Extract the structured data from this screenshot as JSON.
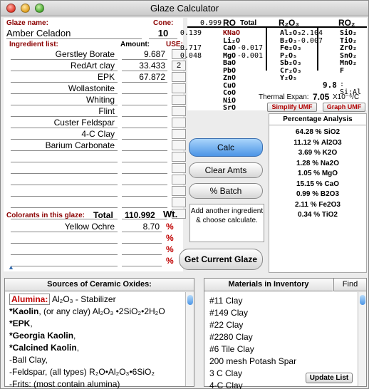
{
  "window": {
    "title": "Glaze Calculator"
  },
  "glaze": {
    "name_label": "Glaze name:",
    "name": "Amber Celadon",
    "cone_label": "Cone:",
    "cone": "10"
  },
  "ingredients": {
    "label": "Ingredient list:",
    "amount_label": "Amount:",
    "use_label": "USE:",
    "rows": [
      {
        "name": "Gerstley Borate",
        "amount": "9.687",
        "use": ""
      },
      {
        "name": "RedArt clay",
        "amount": "33.433",
        "use": "2"
      },
      {
        "name": "EPK",
        "amount": "67.872",
        "use": ""
      },
      {
        "name": "Wollastonite",
        "amount": "",
        "use": ""
      },
      {
        "name": "Whiting",
        "amount": "",
        "use": ""
      },
      {
        "name": "Flint",
        "amount": "",
        "use": ""
      },
      {
        "name": "Custer Feldspar",
        "amount": "",
        "use": ""
      },
      {
        "name": "4-C Clay",
        "amount": "",
        "use": ""
      },
      {
        "name": "Barium Carbonate",
        "amount": "",
        "use": ""
      },
      {
        "name": "",
        "amount": "",
        "use": ""
      },
      {
        "name": "",
        "amount": "",
        "use": ""
      },
      {
        "name": "",
        "amount": "",
        "use": ""
      },
      {
        "name": "",
        "amount": "",
        "use": ""
      },
      {
        "name": "",
        "amount": "",
        "use": ""
      },
      {
        "name": "",
        "amount": "",
        "use": ""
      }
    ]
  },
  "colorants": {
    "label": "Colorants in this glaze:",
    "total_label": "Total",
    "total": "110.992",
    "unit": "Wt.",
    "pct_symbol": "%",
    "rows": [
      {
        "name": "Yellow Ochre",
        "amount": "8.70"
      },
      {
        "name": "",
        "amount": ""
      },
      {
        "name": "",
        "amount": ""
      },
      {
        "name": "",
        "amount": ""
      }
    ]
  },
  "umf": {
    "ro_total_value": "0.999",
    "ro_label": "RO",
    "total_label": "Total",
    "r2o3_label": "R₂O₃",
    "ro2_label": "RO₂",
    "ro": [
      {
        "value": "0.139",
        "oxide": "KNaO"
      },
      {
        "value": "",
        "oxide": "Li₂O"
      },
      {
        "value": "0.717",
        "oxide": "CaO"
      },
      {
        "value": "0.048",
        "oxide": "MgO"
      },
      {
        "value": "",
        "oxide": "BaO"
      },
      {
        "value": "",
        "oxide": "PbO"
      },
      {
        "value": "",
        "oxide": "ZnO"
      },
      {
        "value": "",
        "oxide": "CuO"
      },
      {
        "value": "",
        "oxide": "CoO"
      },
      {
        "value": "",
        "oxide": "NiO"
      },
      {
        "value": "",
        "oxide": "SrO"
      }
    ],
    "r2o3": [
      {
        "value": "",
        "oxide": "Al₂O₃"
      },
      {
        "value": "",
        "oxide": "B₂O₃"
      },
      {
        "value": "-0.017",
        "oxide": "Fe₂O₃"
      },
      {
        "value": "-0.001",
        "oxide": "P₂O₅"
      },
      {
        "value": "",
        "oxide": "Sb₂O₃"
      },
      {
        "value": "",
        "oxide": "Cr₂O₃"
      },
      {
        "value": "",
        "oxide": "Y₂O₅"
      }
    ],
    "ro2": [
      {
        "value": "2.104",
        "oxide": "SiO₂"
      },
      {
        "value": "-0.007",
        "oxide": "TiO₂"
      },
      {
        "value": "",
        "oxide": "ZrO₂"
      },
      {
        "value": "",
        "oxide": "SnO₂"
      },
      {
        "value": "",
        "oxide": "MnO₂"
      },
      {
        "value": "",
        "oxide": "F"
      }
    ],
    "si_al_value": "9.8",
    "si_al_label": ": Si:Al",
    "expansion_label": "Thermal Expan:",
    "expansion_value": "7.05",
    "expansion_unit": "X10⁻⁶/C",
    "simplify_button": "Simplify UMF",
    "graph_button": "Graph UMF"
  },
  "buttons": {
    "calc": "Calc",
    "clear": "Clear Amts",
    "batch": "% Batch",
    "current": "Get Current Glaze"
  },
  "info_text": "Add another ingredient & choose calculate.",
  "percentage": {
    "title": "Percentage Analysis",
    "lines": [
      "64.28 % SiO2",
      "11.12 % Al2O3",
      "3.69 % K2O",
      "1.28 % Na2O",
      "1.05 % MgO",
      "15.15 % CaO",
      "0.99 % B2O3",
      "2.11 % Fe2O3",
      "0.34 % TiO2"
    ]
  },
  "sources": {
    "title": "Sources of Ceramic Oxides:",
    "oxide_name": "Alumina:",
    "oxide_formula": "Al₂O₃",
    "oxide_role": "- Stabilizer",
    "lines": [
      {
        "bold": "*Kaolin",
        "rest": ", (or any clay)  Al₂O₃ •2SiO₂•2H₂O"
      },
      {
        "bold": "*EPK",
        "rest": ","
      },
      {
        "bold": "*Georgia Kaolin",
        "rest": ","
      },
      {
        "bold": "*Calcined Kaolin",
        "rest": ","
      },
      {
        "bold": "",
        "rest": "-Ball Clay,"
      },
      {
        "bold": "",
        "rest": "-Feldspar, (all types) R₂O•Al₂O₃•6SiO₂"
      },
      {
        "bold": "",
        "rest": "-Frits: (most contain alumina)"
      }
    ]
  },
  "inventory": {
    "title": "Materials in Inventory",
    "find_button": "Find",
    "update_button": "Update List",
    "items": [
      "#11 Clay",
      "#149 Clay",
      "#22 Clay",
      "#2280 Clay",
      "#6 Tile Clay",
      "200 mesh Potash Spar",
      "3 C Clay",
      "4-C Clay"
    ]
  }
}
